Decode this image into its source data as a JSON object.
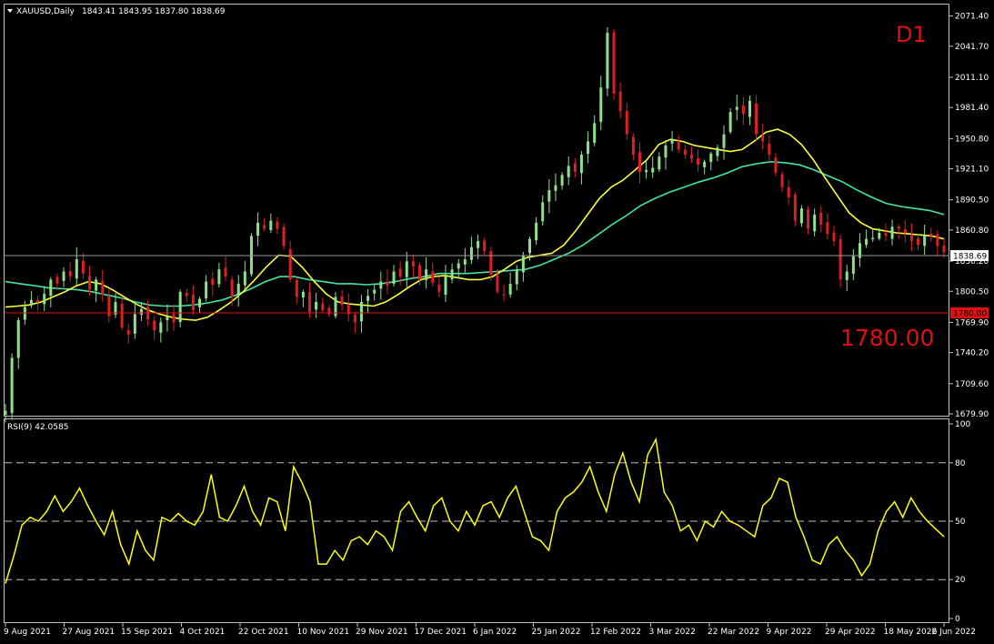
{
  "chart_data": {
    "type": "candlestick",
    "symbol_line": "XAUUSD,Daily",
    "ohlc_text": "1843.41 1843.95 1837.80 1838.69",
    "timeframe_label": "D1",
    "level_label": "1780.00",
    "level_value": 1780.0,
    "current_price_label": "1838.69",
    "current_price": 1838.69,
    "level_tag": "1780.00",
    "price_axis": {
      "min": 1679.9,
      "max": 2080.0,
      "ticks": [
        "2071.40",
        "2041.70",
        "2011.10",
        "1981.40",
        "1950.80",
        "1921.10",
        "1890.50",
        "1860.80",
        "1830.20",
        "1800.50",
        "1769.90",
        "1740.20",
        "1709.60",
        "1679.90"
      ]
    },
    "date_axis": [
      "9 Aug 2021",
      "27 Aug 2021",
      "15 Sep 2021",
      "4 Oct 2021",
      "22 Oct 2021",
      "10 Nov 2021",
      "29 Nov 2021",
      "17 Dec 2021",
      "6 Jan 2022",
      "25 Jan 2022",
      "12 Feb 2022",
      "3 Mar 2022",
      "22 Mar 2022",
      "9 Apr 2022",
      "29 Apr 2022",
      "18 May 2022",
      "6 Jun 2022"
    ],
    "price_path": [
      1683,
      1735,
      1772,
      1785,
      1792,
      1790,
      1798,
      1812,
      1808,
      1820,
      1815,
      1832,
      1818,
      1802,
      1812,
      1797,
      1776,
      1790,
      1765,
      1758,
      1778,
      1783,
      1773,
      1762,
      1770,
      1776,
      1770,
      1800,
      1796,
      1782,
      1793,
      1810,
      1807,
      1822,
      1815,
      1795,
      1808,
      1820,
      1855,
      1868,
      1862,
      1870,
      1862,
      1845,
      1812,
      1795,
      1800,
      1780,
      1790,
      1782,
      1778,
      1795,
      1787,
      1778,
      1770,
      1790,
      1796,
      1802,
      1810,
      1806,
      1820,
      1815,
      1830,
      1825,
      1812,
      1822,
      1809,
      1800,
      1815,
      1822,
      1828,
      1832,
      1844,
      1850,
      1840,
      1817,
      1800,
      1797,
      1808,
      1822,
      1836,
      1852,
      1868,
      1888,
      1900,
      1905,
      1915,
      1924,
      1918,
      1935,
      1948,
      1966,
      2001,
      2055,
      1995,
      1978,
      1955,
      1935,
      1918,
      1920,
      1922,
      1933,
      1944,
      1950,
      1940,
      1935,
      1931,
      1925,
      1928,
      1936,
      1942,
      1955,
      1977,
      1982,
      1975,
      1988,
      1955,
      1948,
      1935,
      1917,
      1903,
      1893,
      1870,
      1882,
      1862,
      1876,
      1866,
      1857,
      1850,
      1812,
      1820,
      1835,
      1848,
      1852,
      1853,
      1858,
      1855,
      1864,
      1862,
      1858,
      1850,
      1846,
      1855,
      1855,
      1845,
      1839
    ],
    "ma_fast": [
      1785,
      1786,
      1787,
      1790,
      1795,
      1800,
      1806,
      1810,
      1808,
      1802,
      1795,
      1788,
      1782,
      1778,
      1775,
      1773,
      1772,
      1775,
      1782,
      1790,
      1800,
      1812,
      1825,
      1836,
      1835,
      1824,
      1810,
      1798,
      1790,
      1788,
      1787,
      1786,
      1790,
      1797,
      1805,
      1812,
      1815,
      1816,
      1814,
      1812,
      1812,
      1815,
      1822,
      1830,
      1834,
      1836,
      1838,
      1846,
      1860,
      1876,
      1892,
      1903,
      1910,
      1920,
      1930,
      1945,
      1950,
      1948,
      1944,
      1942,
      1940,
      1938,
      1940,
      1948,
      1957,
      1960,
      1955,
      1945,
      1930,
      1912,
      1895,
      1878,
      1868,
      1862,
      1860,
      1858,
      1857,
      1856,
      1855,
      1852
    ],
    "ma_slow": [
      1810,
      1808,
      1806,
      1804,
      1803,
      1802,
      1800,
      1797,
      1794,
      1790,
      1787,
      1786,
      1786,
      1787,
      1789,
      1792,
      1797,
      1803,
      1810,
      1815,
      1815,
      1812,
      1810,
      1808,
      1808,
      1807,
      1808,
      1810,
      1813,
      1815,
      1818,
      1818,
      1818,
      1819,
      1820,
      1821,
      1822,
      1826,
      1832,
      1838,
      1846,
      1856,
      1866,
      1875,
      1885,
      1892,
      1898,
      1903,
      1908,
      1912,
      1917,
      1923,
      1926,
      1928,
      1927,
      1925,
      1920,
      1914,
      1908,
      1900,
      1893,
      1887,
      1884,
      1882,
      1880,
      1876
    ],
    "rsi": {
      "label": "RSI(9) 42.0585",
      "period": 9,
      "last_value": 42.0585,
      "ylim": [
        0,
        100
      ],
      "levels": [
        "80",
        "50",
        "20"
      ],
      "axis_ticks": [
        "100",
        "80",
        "50",
        "20",
        "0"
      ],
      "values": [
        18,
        32,
        48,
        52,
        50,
        55,
        63,
        55,
        60,
        67,
        58,
        50,
        43,
        55,
        38,
        28,
        45,
        35,
        30,
        52,
        50,
        54,
        50,
        48,
        55,
        74,
        52,
        50,
        58,
        68,
        55,
        48,
        62,
        60,
        45,
        78,
        70,
        60,
        28,
        28,
        35,
        30,
        40,
        42,
        38,
        45,
        42,
        35,
        55,
        60,
        52,
        45,
        58,
        62,
        50,
        45,
        55,
        48,
        58,
        60,
        52,
        62,
        68,
        55,
        42,
        40,
        35,
        55,
        62,
        65,
        70,
        78,
        65,
        55,
        74,
        85,
        70,
        60,
        84,
        92,
        65,
        58,
        45,
        48,
        40,
        50,
        47,
        55,
        50,
        48,
        45,
        42,
        58,
        62,
        72,
        70,
        52,
        42,
        30,
        28,
        38,
        42,
        35,
        30,
        22,
        28,
        45,
        55,
        60,
        52,
        62,
        55,
        50,
        46,
        42
      ]
    }
  }
}
